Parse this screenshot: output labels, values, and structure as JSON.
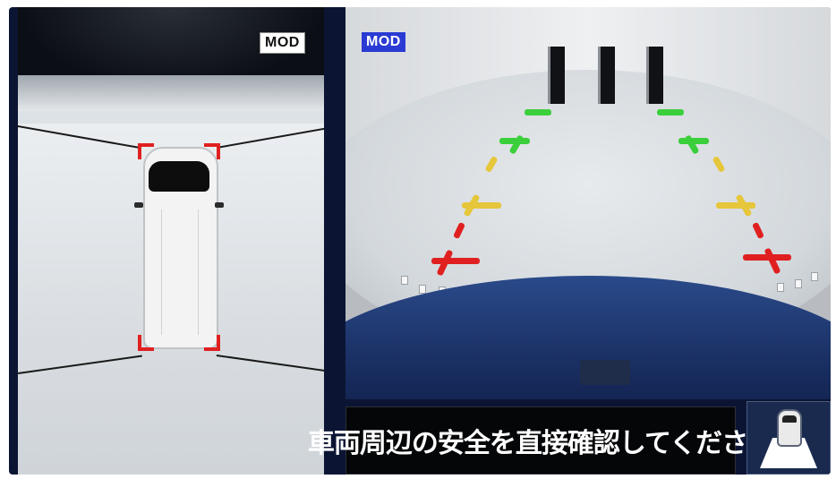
{
  "left_view": {
    "mod_label": "MOD"
  },
  "rear_view": {
    "mod_label": "MOD"
  },
  "message": {
    "text": "車両周辺の安全を直接確認してください"
  },
  "colors": {
    "mod_badge_blue": "#2a3bd3",
    "guide_green": "#3bcf3b",
    "guide_yellow": "#e6c63a",
    "guide_red": "#e02020",
    "corner_marker": "#e02020"
  },
  "icons": {
    "view_toggle": "car-top-view-icon"
  }
}
